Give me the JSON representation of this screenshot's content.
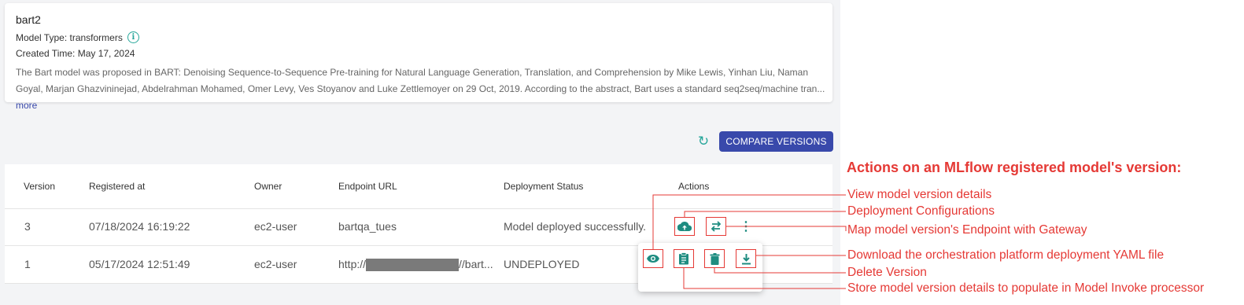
{
  "model": {
    "name": "bart2",
    "type_text": "Model Type: transformers",
    "created_text": "Created Time: May 17, 2024",
    "description": "The Bart model was proposed in BART: Denoising Sequence-to-Sequence Pre-training for Natural Language Generation, Translation, and Comprehension by Mike Lewis, Yinhan Liu, Naman Goyal, Marjan Ghazvininejad, Abdelrahman Mohamed, Omer Levy, Ves Stoyanov and Luke Zettlemoyer on 29 Oct, 2019. According to the abstract, Bart uses a standard seq2seq/machine tran...",
    "more_label": "more",
    "info_icon": "info-icon"
  },
  "toolbar": {
    "refresh_icon": "refresh-icon",
    "compare_label": "COMPARE VERSIONS"
  },
  "table": {
    "headers": [
      "Version",
      "Registered at",
      "Owner",
      "Endpoint URL",
      "Deployment Status",
      "Actions"
    ],
    "rows": [
      {
        "version": "3",
        "registered_at": "07/18/2024 16:19:22",
        "owner": "ec2-user",
        "endpoint_url": "bartqa_tues",
        "status": "Model deployed successfully."
      },
      {
        "version": "1",
        "registered_at": "05/17/2024 12:51:49",
        "owner": "ec2-user",
        "endpoint_prefix": "http://",
        "endpoint_suffix": "//bart...",
        "status": "UNDEPLOYED"
      }
    ]
  },
  "actions": {
    "row_icons": [
      "cloud-upload-icon",
      "swap-horiz-icon",
      "more-vert-icon"
    ],
    "menu_icons": [
      "eye-icon",
      "clipboard-icon",
      "trash-icon",
      "download-icon"
    ]
  },
  "annotations": {
    "title": "Actions on an MLflow registered model's version:",
    "items": [
      "View model version details",
      "Deployment Configurations",
      "Map model version's Endpoint with Gateway",
      "Download the orchestration platform deployment YAML file",
      "Delete Version",
      "Store model version details to populate in Model Invoke processor"
    ],
    "color": "#e53935"
  },
  "colors": {
    "primary_button": "#3949ab",
    "icon_teal": "#26a69a",
    "link": "#3949ab"
  }
}
